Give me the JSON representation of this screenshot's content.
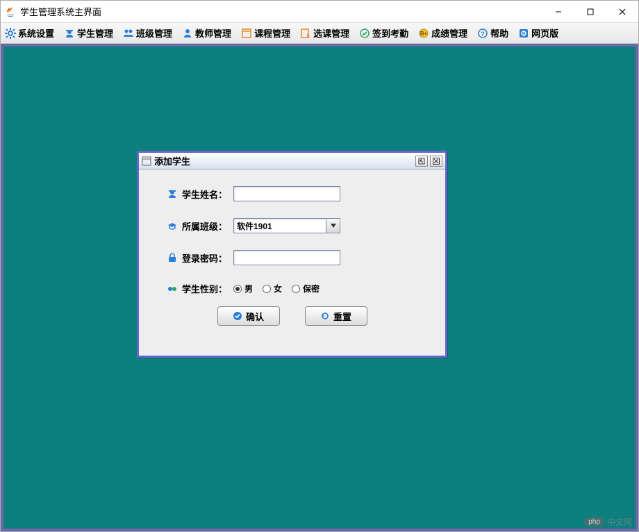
{
  "window": {
    "title": "学生管理系统主界面"
  },
  "toolbar": {
    "items": [
      {
        "icon": "gear-icon",
        "label": "系统设置"
      },
      {
        "icon": "student-icon",
        "label": "学生管理"
      },
      {
        "icon": "class-icon",
        "label": "班级管理"
      },
      {
        "icon": "teacher-icon",
        "label": "教师管理"
      },
      {
        "icon": "course-icon",
        "label": "课程管理"
      },
      {
        "icon": "selection-icon",
        "label": "选课管理"
      },
      {
        "icon": "attendance-icon",
        "label": "签到考勤"
      },
      {
        "icon": "grades-icon",
        "label": "成绩管理"
      },
      {
        "icon": "help-icon",
        "label": "帮助"
      },
      {
        "icon": "web-icon",
        "label": "网页版"
      }
    ]
  },
  "dialog": {
    "title": "添加学生",
    "fields": {
      "name": {
        "label": "学生姓名：",
        "value": ""
      },
      "class": {
        "label": "所属班级：",
        "value": "软件1901"
      },
      "password": {
        "label": "登录密码：",
        "value": ""
      },
      "gender": {
        "label": "学生性别：",
        "options": [
          "男",
          "女",
          "保密"
        ],
        "selected": "男"
      }
    },
    "buttons": {
      "ok": "确认",
      "reset": "重置"
    }
  },
  "watermark": {
    "badge": "php",
    "text": "中文网"
  }
}
